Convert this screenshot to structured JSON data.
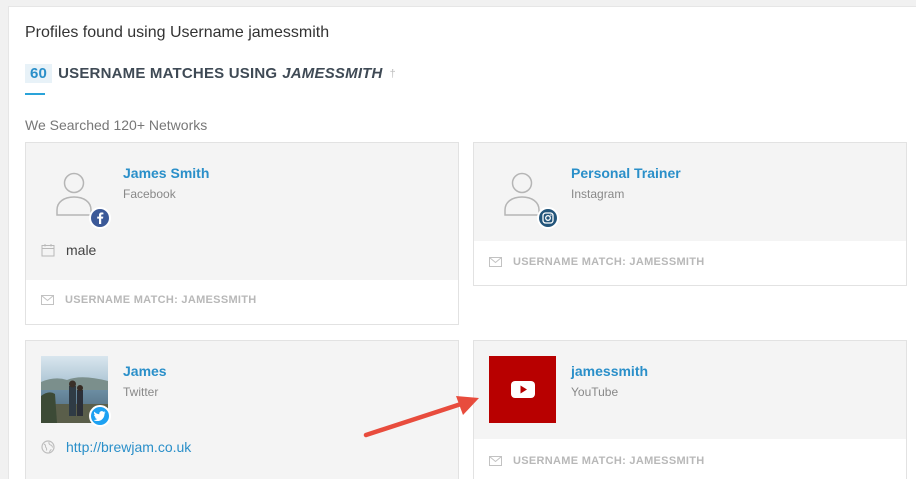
{
  "header": {
    "title": "Profiles found using Username jamessmith",
    "match_count": "60",
    "match_label": "USERNAME MATCHES USING",
    "match_username": "JAMESSMITH",
    "dagger": "†",
    "searched": "We Searched 120+ Networks"
  },
  "cards": [
    {
      "name": "James Smith",
      "network": "Facebook",
      "detail": "male",
      "footer": "USERNAME MATCH: JAMESSMITH",
      "icon": "facebook-icon",
      "badge_color": "#3b5998"
    },
    {
      "name": "Personal Trainer",
      "network": "Instagram",
      "footer": "USERNAME MATCH: JAMESSMITH",
      "icon": "instagram-icon",
      "badge_color": "#23557a"
    },
    {
      "name": "James",
      "network": "Twitter",
      "link": "http://brewjam.co.uk",
      "icon": "twitter-icon",
      "badge_color": "#1da1f2"
    },
    {
      "name": "jamessmith",
      "network": "YouTube",
      "footer": "USERNAME MATCH: JAMESSMITH",
      "icon": "youtube-icon",
      "tile_color": "#b80000"
    }
  ],
  "colors": {
    "accent": "#2a8fc9",
    "arrow": "#e84c3d"
  }
}
